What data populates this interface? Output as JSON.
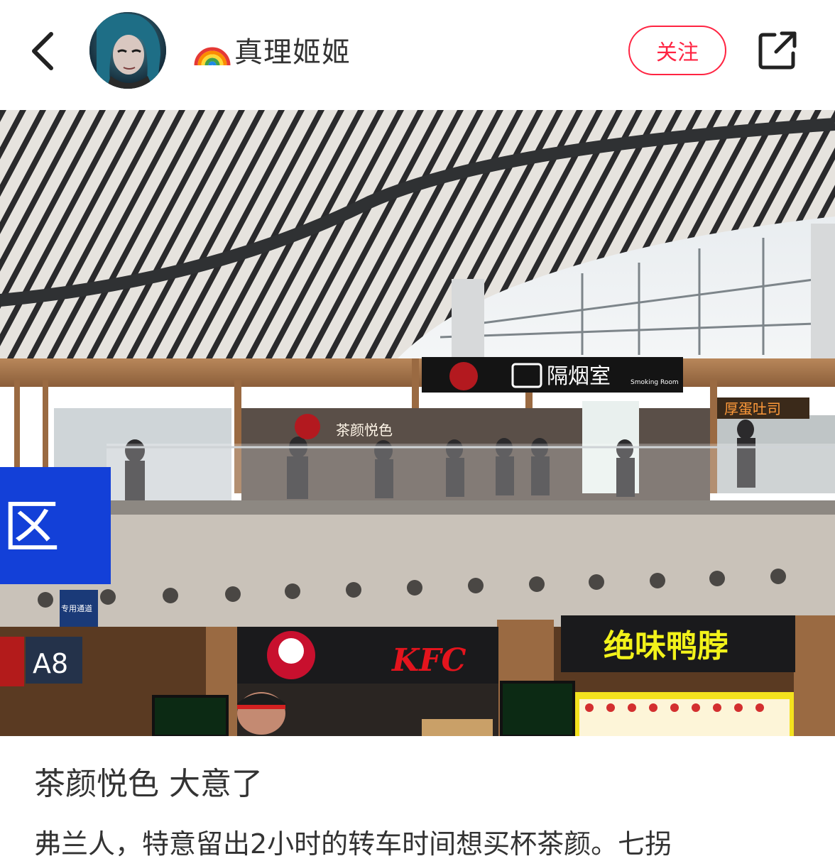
{
  "header": {
    "back_icon": "chevron-left-icon",
    "avatar_alt": "",
    "username": "真理姬姬",
    "username_emoji": "rainbow-icon",
    "follow_label": "关注",
    "share_icon": "share-icon"
  },
  "photo": {
    "signs": {
      "smoking_room": "隔烟室",
      "smoking_room_sub": "Smoking Room",
      "tea_shop": "茶颜悦色",
      "toast_shop": "厚蛋吐司",
      "kfc": "KFC",
      "duck_shop": "绝味鸭脖",
      "gate": "A8",
      "zone": "区",
      "channel": "专用通道"
    }
  },
  "note": {
    "title": "茶颜悦色 大意了",
    "body": "弗兰人，特意留出2小时的转车时间想买杯茶颜。七拐"
  },
  "colors": {
    "accent": "#ff2442",
    "text": "#333333"
  }
}
